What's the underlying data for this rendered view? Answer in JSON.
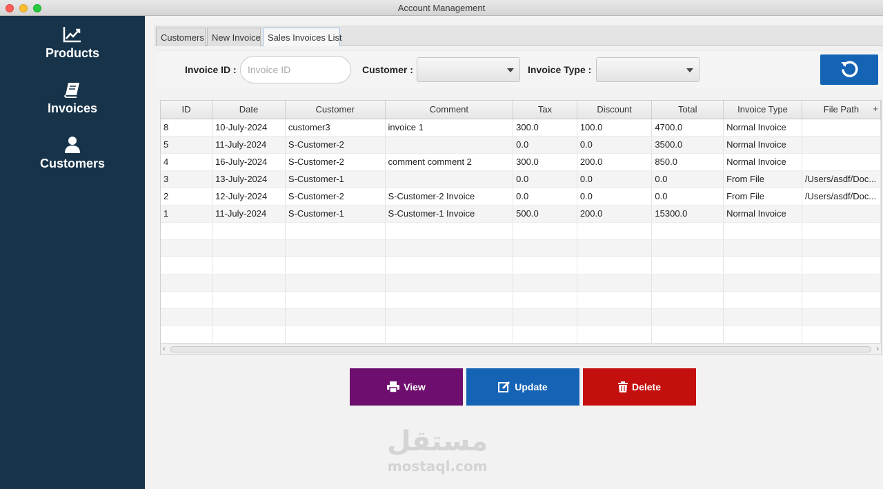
{
  "window": {
    "title": "Account Management"
  },
  "sidebar": {
    "items": [
      {
        "label": "Products",
        "icon": "chart-line-icon"
      },
      {
        "label": "Invoices",
        "icon": "book-icon"
      },
      {
        "label": "Customers",
        "icon": "user-icon"
      }
    ]
  },
  "tabs": [
    {
      "label": "Customers",
      "active": false
    },
    {
      "label": "New Invoice",
      "active": false
    },
    {
      "label": "Sales Invoices List",
      "active": true
    }
  ],
  "filters": {
    "invoice_id_label": "Invoice ID :",
    "invoice_id_placeholder": "Invoice ID",
    "invoice_id_value": "",
    "customer_label": "Customer :",
    "customer_value": "",
    "invoice_type_label": "Invoice Type :",
    "invoice_type_value": ""
  },
  "table": {
    "columns": [
      "ID",
      "Date",
      "Customer",
      "Comment",
      "Tax",
      "Discount",
      "Total",
      "Invoice Type",
      "File Path"
    ],
    "rows": [
      [
        "8",
        "10-July-2024",
        "customer3",
        "invoice 1",
        "300.0",
        "100.0",
        "4700.0",
        "Normal Invoice",
        ""
      ],
      [
        "5",
        "11-July-2024",
        "S-Customer-2",
        "",
        "0.0",
        "0.0",
        "3500.0",
        "Normal Invoice",
        ""
      ],
      [
        "4",
        "16-July-2024",
        "S-Customer-2",
        "comment comment 2",
        "300.0",
        "200.0",
        "850.0",
        "Normal Invoice",
        ""
      ],
      [
        "3",
        "13-July-2024",
        "S-Customer-1",
        "",
        "0.0",
        "0.0",
        "0.0",
        "From File",
        "/Users/asdf/Doc..."
      ],
      [
        "2",
        "12-July-2024",
        "S-Customer-2",
        "S-Customer-2 Invoice",
        "0.0",
        "0.0",
        "0.0",
        "From File",
        "/Users/asdf/Doc..."
      ],
      [
        "1",
        "11-July-2024",
        "S-Customer-1",
        "S-Customer-1 Invoice",
        "500.0",
        "200.0",
        "15300.0",
        "Normal Invoice",
        ""
      ]
    ],
    "empty_rows": 7
  },
  "actions": {
    "view_label": "View",
    "update_label": "Update",
    "delete_label": "Delete"
  },
  "colors": {
    "sidebar": "#17334a",
    "view": "#6e0e6e",
    "update": "#1463b4",
    "delete": "#c40f0f",
    "refresh": "#1463b4"
  },
  "watermark": {
    "arabic": "مستقل",
    "latin": "mostaql.com"
  }
}
